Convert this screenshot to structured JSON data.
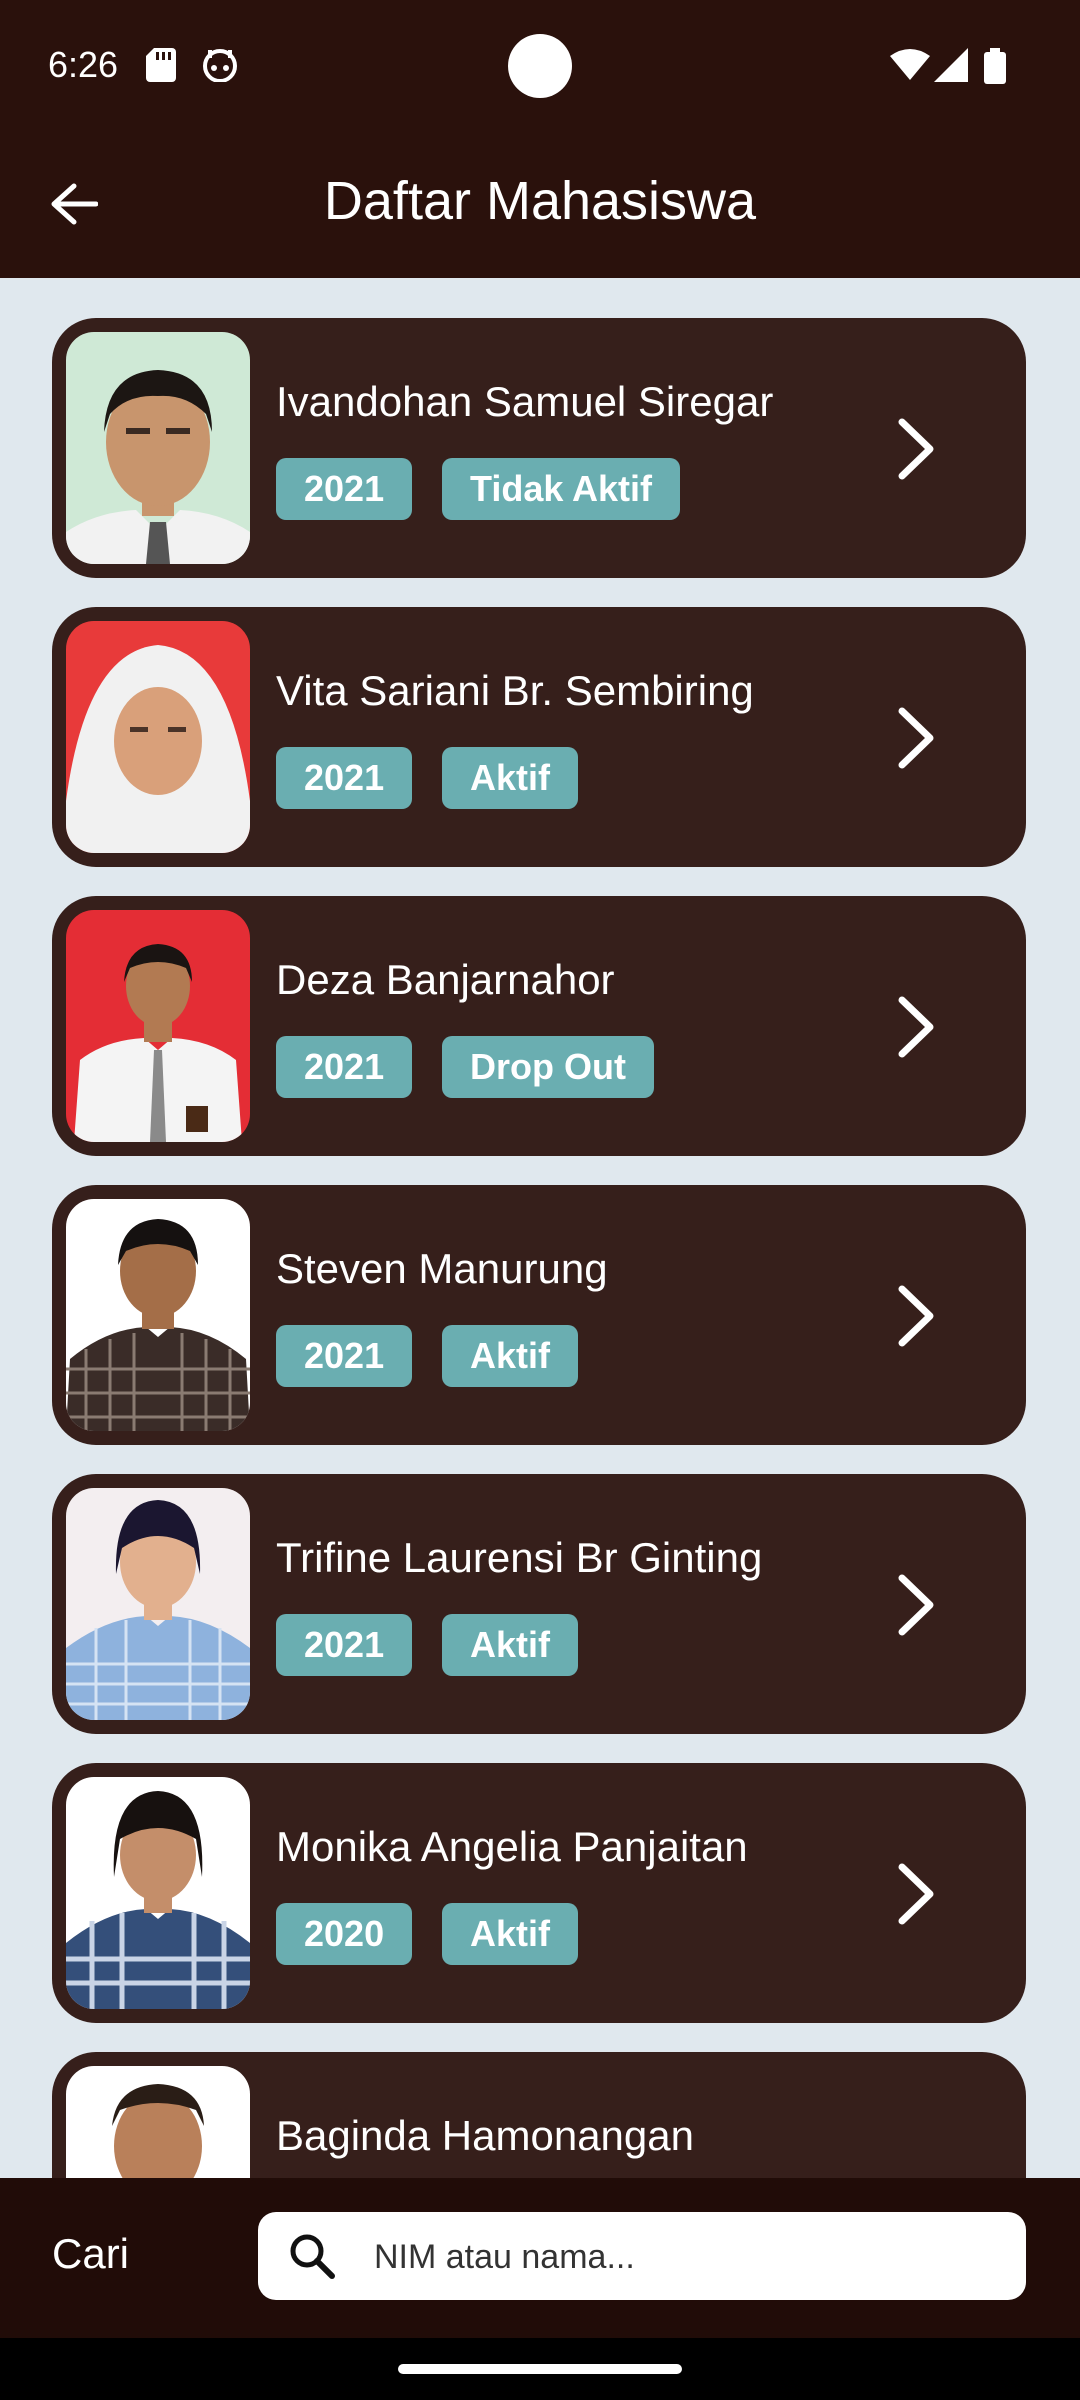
{
  "status": {
    "time": "6:26",
    "icons": [
      "sd-card-icon",
      "android-head-icon",
      "wifi-icon",
      "signal-icon",
      "battery-icon"
    ]
  },
  "appbar": {
    "back_icon": "arrow-left-icon",
    "title": "Daftar Mahasiswa"
  },
  "students": [
    {
      "name": "Ivandohan Samuel Siregar",
      "year": "2021",
      "status": "Tidak Aktif",
      "photo_bg": "#cfe9d6"
    },
    {
      "name": "Vita Sariani Br. Sembiring",
      "year": "2021",
      "status": "Aktif",
      "photo_bg": "#e83a3a"
    },
    {
      "name": "Deza Banjarnahor",
      "year": "2021",
      "status": "Drop Out",
      "photo_bg": "#e42d35"
    },
    {
      "name": "Steven Manurung",
      "year": "2021",
      "status": "Aktif",
      "photo_bg": "#ffffff"
    },
    {
      "name": "Trifine Laurensi Br Ginting",
      "year": "2021",
      "status": "Aktif",
      "photo_bg": "#f3eef0"
    },
    {
      "name": "Monika Angelia Panjaitan",
      "year": "2020",
      "status": "Aktif",
      "photo_bg": "#ffffff"
    },
    {
      "name": "Baginda Hamonangan",
      "photo_bg": "#ffffff"
    }
  ],
  "search": {
    "label": "Cari",
    "placeholder": "NIM atau nama..."
  },
  "colors": {
    "appbar": "#2a110c",
    "card": "#361f1b",
    "chip": "#6aaeb1",
    "list_bg": "#e0e8ee"
  }
}
